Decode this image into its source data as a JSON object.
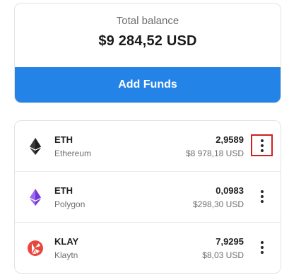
{
  "balance": {
    "label": "Total balance",
    "value": "$9 284,52 USD"
  },
  "add_funds_label": "Add Funds",
  "colors": {
    "accent": "#2483e6",
    "highlight": "#d01f1f",
    "eth_mainnet": "#3a3a3a",
    "eth_polygon": "#8247e5",
    "klay": "#e8473c"
  },
  "assets": [
    {
      "symbol": "ETH",
      "network": "Ethereum",
      "amount": "2,9589",
      "fiat": "$8 978,18 USD",
      "icon": "ethereum-icon"
    },
    {
      "symbol": "ETH",
      "network": "Polygon",
      "amount": "0,0983",
      "fiat": "$298,30 USD",
      "icon": "polygon-ethereum-icon"
    },
    {
      "symbol": "KLAY",
      "network": "Klaytn",
      "amount": "7,9295",
      "fiat": "$8,03 USD",
      "icon": "klaytn-icon"
    }
  ]
}
